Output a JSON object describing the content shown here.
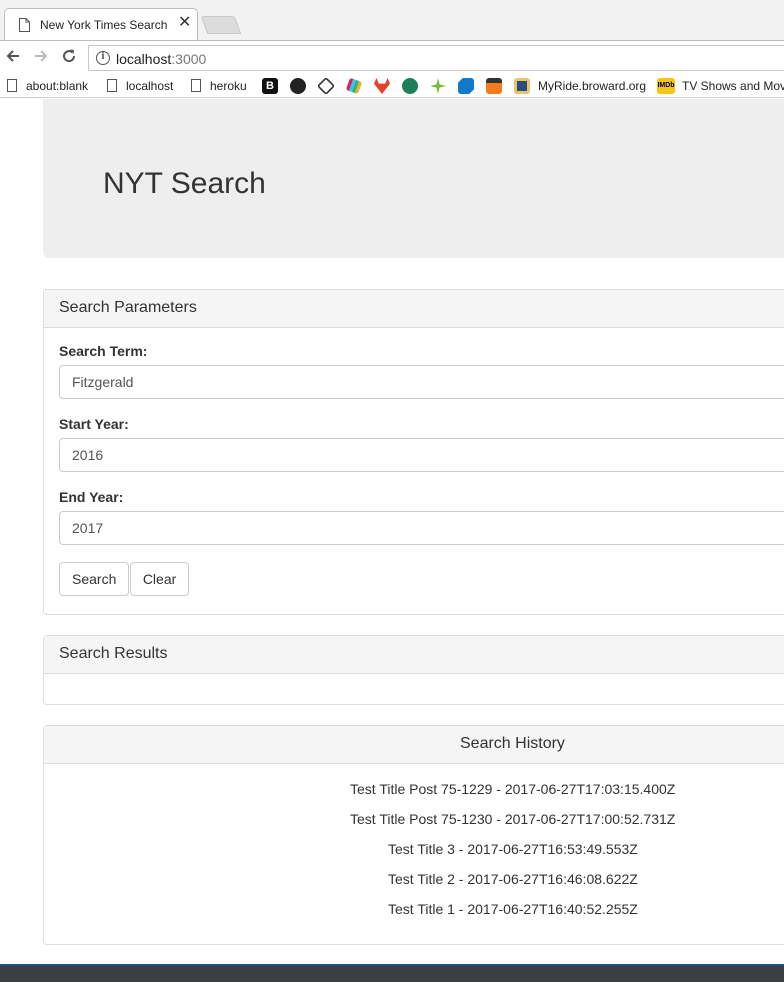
{
  "browser": {
    "tab_title": "New York Times Search",
    "tab_close": "✕",
    "url_host": "localhost",
    "url_port": ":3000",
    "bookmarks": [
      {
        "label": "about:blank"
      },
      {
        "label": "localhost"
      },
      {
        "label": "heroku"
      },
      {
        "label": "MyRide.broward.org"
      },
      {
        "label": "TV Shows and Movies"
      }
    ],
    "bookmark_icons": [
      "B",
      "github-icon",
      "codepen-icon",
      "slack-icon",
      "gitlab-icon",
      "ufc-icon",
      "star-icon",
      "chase-icon",
      "discover-icon",
      "badge-icon",
      "IMDb"
    ]
  },
  "jumbotron": {
    "title": "NYT Search"
  },
  "search_panel": {
    "heading": "Search Parameters",
    "search_term_label": "Search Term:",
    "search_term_value": "Fitzgerald",
    "start_year_label": "Start Year:",
    "start_year_value": "2016",
    "end_year_label": "End Year:",
    "end_year_value": "2017",
    "search_button": "Search",
    "clear_button": "Clear"
  },
  "results_panel": {
    "heading": "Search Results"
  },
  "history_panel": {
    "heading": "Search History",
    "items": [
      "Test Title Post 75-1229 - 2017-06-27T17:03:15.400Z",
      "Test Title Post 75-1230 - 2017-06-27T17:00:52.731Z",
      "Test Title 3 - 2017-06-27T16:53:49.553Z",
      "Test Title 2 - 2017-06-27T16:46:08.622Z",
      "Test Title 1 - 2017-06-27T16:40:52.255Z"
    ]
  },
  "colors": {
    "jumbotron_bg": "#eeeeee",
    "panel_heading_bg": "#f5f5f5",
    "border": "#dddddd"
  }
}
